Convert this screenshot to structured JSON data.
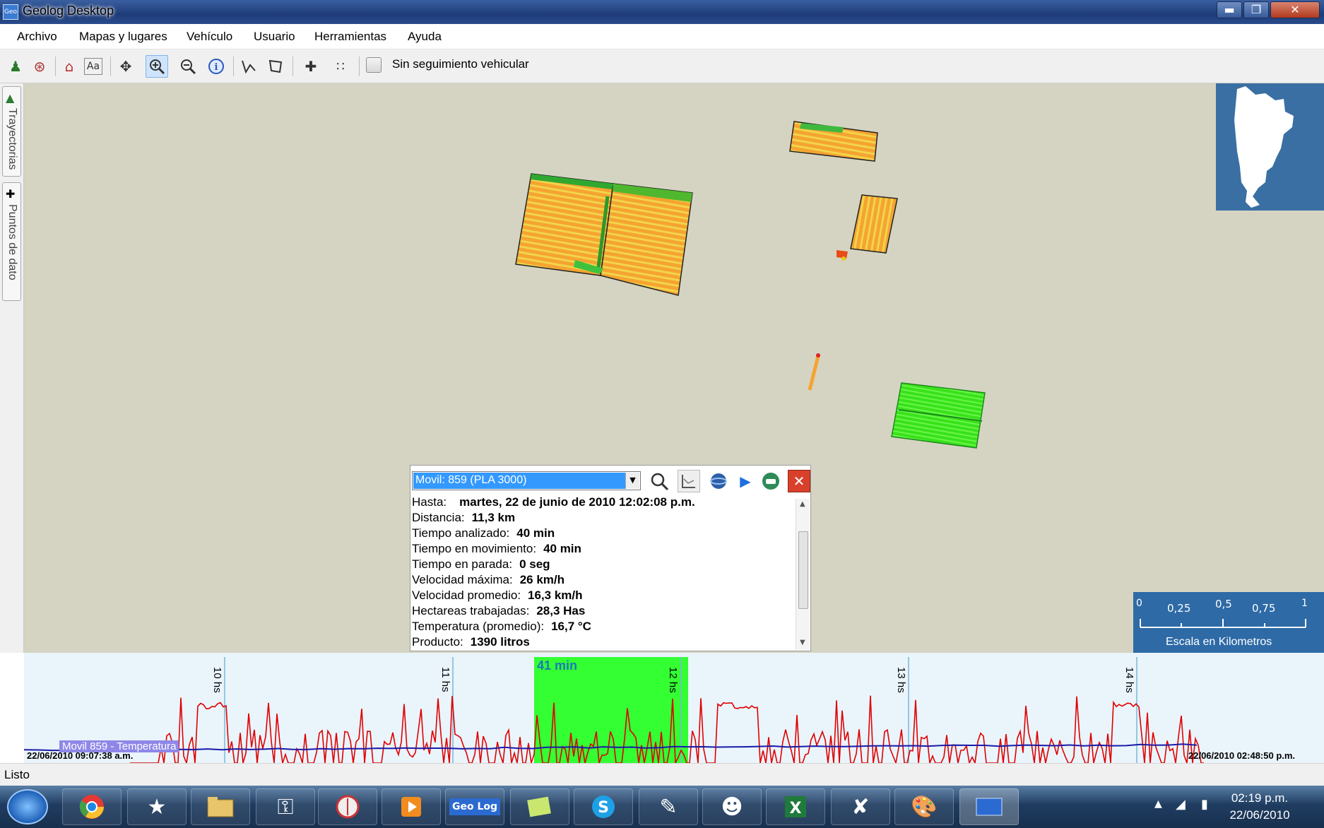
{
  "window": {
    "title": "Geolog Desktop",
    "app_icon_text": "Geo",
    "minimize_label": "▬",
    "maximize_label": "❐",
    "close_label": "✕"
  },
  "menu": [
    "Archivo",
    "Mapas y lugares",
    "Vehículo",
    "Usuario",
    "Herramientas",
    "Ayuda"
  ],
  "toolbar": {
    "tracking_checkbox_label": "Sin seguimiento vehicular",
    "tracking_checked": false,
    "tools": [
      "user-location-icon",
      "antenna-icon",
      "house-icon",
      "text-tool-icon",
      "pan-icon",
      "zoom-in-icon",
      "zoom-out-icon",
      "info-icon",
      "polyline-icon",
      "polygon-icon",
      "crosshair-icon",
      "grid-point-icon"
    ],
    "selected_tool": "zoom-in-icon"
  },
  "side_tabs": [
    "Trayectorias",
    "Puntos de dato"
  ],
  "info_panel": {
    "vehicle": "Movil:  859 (PLA 3000)",
    "rows": [
      {
        "label": "Hasta:",
        "value": "martes, 22 de junio de 2010 12:02:08 p.m."
      },
      {
        "label": "Distancia:",
        "value": "11,3  km"
      },
      {
        "label": "Tiempo analizado:",
        "value": "40 min"
      },
      {
        "label": "Tiempo en movimiento:",
        "value": "40 min"
      },
      {
        "label": "Tiempo en parada:",
        "value": "0 seg"
      },
      {
        "label": "Velocidad máxima:",
        "value": "26 km/h"
      },
      {
        "label": "Velocidad promedio:",
        "value": "16,3 km/h"
      },
      {
        "label": "Hectareas trabajadas:",
        "value": "28,3 Has"
      },
      {
        "label": "Temperatura (promedio):",
        "value": "16,7 °C"
      },
      {
        "label": "Producto:",
        "value": "1390 litros"
      }
    ]
  },
  "scale": {
    "ticks": [
      "0",
      "0,25",
      "0,5",
      "0,75",
      "1"
    ],
    "caption": "Escala en Kilometros"
  },
  "timeline": {
    "hour_labels": [
      "10 hs",
      "11 hs",
      "12 hs",
      "13 hs",
      "14 hs"
    ],
    "selection_label": "41 min",
    "series_label": "Movil 859 - Temperatura",
    "start_time": "22/06/2010 09:07:38 a.m.",
    "end_time": "22/06/2010 02:48:50 p.m.",
    "colors": {
      "speed": "#e00000",
      "temperature": "#1a1aa8",
      "selection": "#33ff33"
    }
  },
  "status": "Listo",
  "taskbar": {
    "apps": [
      "chrome-icon",
      "network-icon",
      "folder-icon",
      "lock-icon",
      "compass-icon",
      "media-player-icon",
      "geolog-icon",
      "notes-icon",
      "skype-icon",
      "notepad-icon",
      "messenger-icon",
      "excel-icon",
      "tool-icon",
      "paint-icon",
      "geolog-active-icon"
    ],
    "geolog_label": "Geo Log",
    "clock_time": "02:19 p.m.",
    "clock_date": "22/06/2010"
  }
}
